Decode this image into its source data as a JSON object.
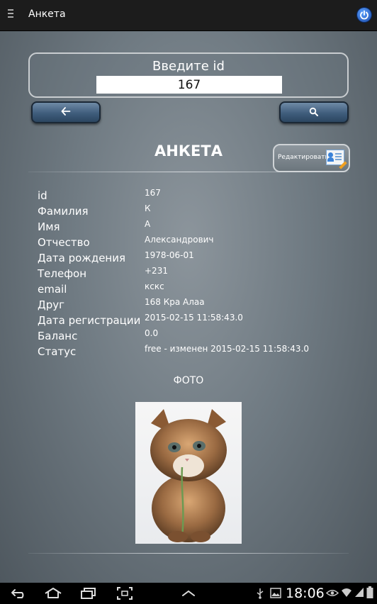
{
  "app": {
    "title": "Анкета"
  },
  "search": {
    "label": "Введите id",
    "value": "167"
  },
  "profile": {
    "heading": "АНКЕТА",
    "edit_label": "Редактировать",
    "fields": [
      {
        "label": "id",
        "value": "167"
      },
      {
        "label": "Фамилия",
        "value": "К"
      },
      {
        "label": "Имя",
        "value": "А"
      },
      {
        "label": "Отчество",
        "value": "Александрович"
      },
      {
        "label": "Дата рождения",
        "value": "1978-06-01"
      },
      {
        "label": "Телефон",
        "value": "+231"
      },
      {
        "label": "email",
        "value": "кскс"
      },
      {
        "label": "Друг",
        "value": "168  Кра Алаа"
      },
      {
        "label": "Дата регистрации",
        "value": "2015-02-15 11:58:43.0"
      },
      {
        "label": "Баланс",
        "value": "0.0"
      },
      {
        "label": "Статус",
        "value": "free - изменен 2015-02-15 11:58:43.0"
      }
    ],
    "photo_title": "ФОТО"
  },
  "icons": {
    "menu": "menu-icon",
    "power": "power-icon",
    "back": "arrow-left-icon",
    "search": "search-icon",
    "edit": "edit-profile-icon"
  },
  "system_bar": {
    "time": "18:06"
  },
  "colors": {
    "topbar": "#1c1c1c",
    "button_blue": "#3f5d7c",
    "power_blue": "#1b4aa8",
    "background": "#6f7a82"
  }
}
